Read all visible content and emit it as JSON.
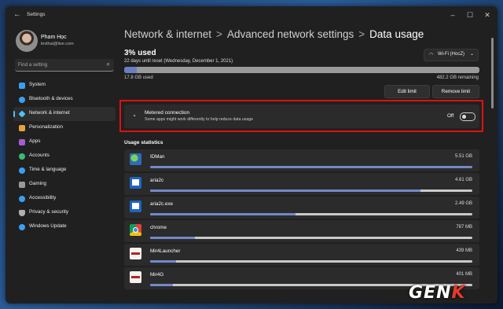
{
  "window": {
    "title": "Settings",
    "controls": [
      "–",
      "☐",
      "✕"
    ]
  },
  "profile": {
    "name": "Pham Học",
    "email": "lexthai@live.com"
  },
  "search": {
    "placeholder": "Find a setting"
  },
  "nav": {
    "items": [
      {
        "label": "System",
        "color": "#3b9ff0"
      },
      {
        "label": "Bluetooth & devices",
        "color": "#3b9ff0"
      },
      {
        "label": "Network & internet",
        "color": "#4cc2ff",
        "active": true
      },
      {
        "label": "Personalization",
        "color": "#e8a23a"
      },
      {
        "label": "Apps",
        "color": "#a55bd8"
      },
      {
        "label": "Accounts",
        "color": "#3cb878"
      },
      {
        "label": "Time & language",
        "color": "#3b9ff0"
      },
      {
        "label": "Gaming",
        "color": "#9a9a9a"
      },
      {
        "label": "Accessibility",
        "color": "#3b9ff0"
      },
      {
        "label": "Privacy & security",
        "color": "#b0b0b0"
      },
      {
        "label": "Windows Update",
        "color": "#3b9ff0"
      }
    ]
  },
  "breadcrumb": {
    "part1": "Network & internet",
    "part2": "Advanced network settings",
    "part3": "Data usage",
    "sep": ">"
  },
  "usage": {
    "percent_label": "3% used",
    "reset_text": "22 days until reset (Wednesday, December 1, 2021)",
    "used": "17.8 GB used",
    "remaining": "482.2 GB remaining",
    "fraction_used": 0.036,
    "network": "Wi-Fi (HocZ)"
  },
  "buttons": {
    "edit_limit": "Edit limit",
    "remove_limit": "Remove limit"
  },
  "metered": {
    "title": "Metered connection",
    "description": "Some apps might work differently to help reduce data usage",
    "state": "Off"
  },
  "usage_stats": {
    "heading": "Usage statistics",
    "apps": [
      {
        "name": "IDMan",
        "value": "5.51 GB",
        "fraction": 1.0,
        "icon": "idman-icon"
      },
      {
        "name": "aria2c",
        "value": "4.61 GB",
        "fraction": 0.84,
        "icon": "aria2c-icon"
      },
      {
        "name": "aria2c.exe",
        "value": "2.49 GB",
        "fraction": 0.45,
        "icon": "aria2c-icon"
      },
      {
        "name": "chrome",
        "value": "787 MB",
        "fraction": 0.14,
        "icon": "chrome-icon"
      },
      {
        "name": "Mir4Launcher",
        "value": "439 MB",
        "fraction": 0.08,
        "icon": "mir4-icon"
      },
      {
        "name": "Mir4G",
        "value": "401 MB",
        "fraction": 0.07,
        "icon": "mir4-icon"
      }
    ]
  },
  "watermark": {
    "text": "GENK"
  }
}
